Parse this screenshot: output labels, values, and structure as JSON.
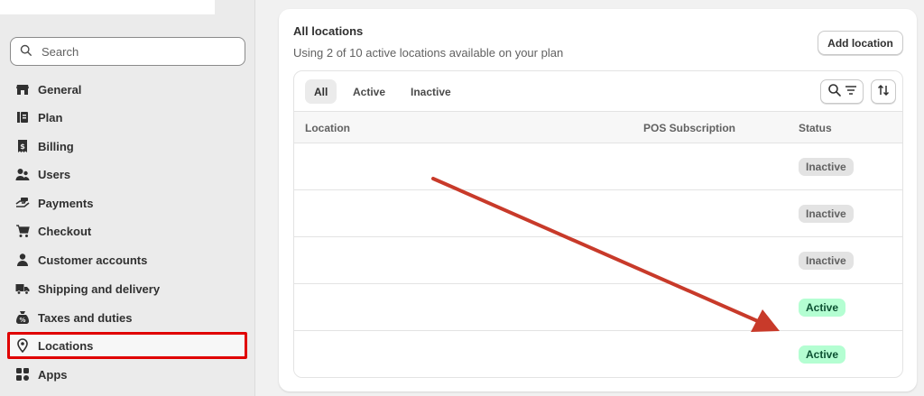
{
  "sidebar": {
    "search_placeholder": "Search",
    "items": [
      {
        "label": "General",
        "icon": "store-icon"
      },
      {
        "label": "Plan",
        "icon": "plan-icon"
      },
      {
        "label": "Billing",
        "icon": "billing-icon"
      },
      {
        "label": "Users",
        "icon": "users-icon"
      },
      {
        "label": "Payments",
        "icon": "payments-icon"
      },
      {
        "label": "Checkout",
        "icon": "cart-icon"
      },
      {
        "label": "Customer accounts",
        "icon": "person-icon"
      },
      {
        "label": "Shipping and delivery",
        "icon": "truck-icon"
      },
      {
        "label": "Taxes and duties",
        "icon": "tax-icon"
      },
      {
        "label": "Locations",
        "icon": "location-pin-icon",
        "active": true
      },
      {
        "label": "Apps",
        "icon": "apps-icon"
      }
    ]
  },
  "card": {
    "title": "All locations",
    "subtitle": "Using 2 of 10 active locations available on your plan",
    "add_button": "Add location"
  },
  "tabs": [
    "All",
    "Active",
    "Inactive"
  ],
  "table": {
    "columns": [
      "Location",
      "POS Subscription",
      "Status"
    ],
    "rows": [
      {
        "status": "Inactive"
      },
      {
        "status": "Inactive"
      },
      {
        "status": "Inactive"
      },
      {
        "status": "Active"
      },
      {
        "status": "Active"
      }
    ]
  },
  "colors": {
    "highlight": "#e00000",
    "arrow": "#c83a2a",
    "active_badge_bg": "#b4fed2",
    "inactive_badge_bg": "#e3e3e3"
  }
}
